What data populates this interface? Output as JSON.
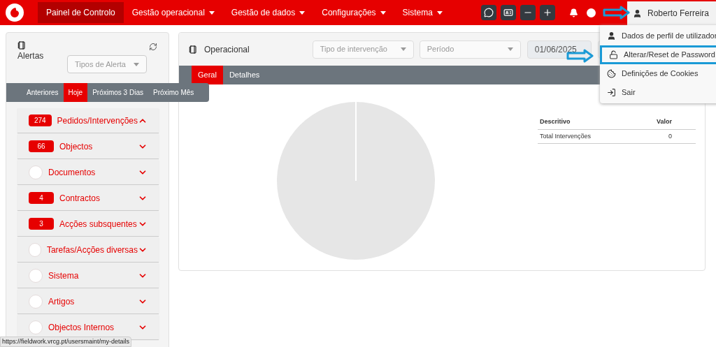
{
  "navbar": {
    "items": [
      {
        "label": "Painel de Controlo",
        "selected": true,
        "dropdown": false
      },
      {
        "label": "Gestão operacional",
        "selected": false,
        "dropdown": true
      },
      {
        "label": "Gestão de dados",
        "selected": false,
        "dropdown": true
      },
      {
        "label": "Configurações",
        "selected": false,
        "dropdown": true
      },
      {
        "label": "Sistema",
        "selected": false,
        "dropdown": true
      }
    ],
    "user": "Roberto Ferreira"
  },
  "user_menu": {
    "items": [
      {
        "label": "Dados de perfil de utilizador",
        "highlighted": false
      },
      {
        "label": "Alterar/Reset de Password",
        "highlighted": true
      },
      {
        "label": "Definições de Cookies",
        "highlighted": false
      },
      {
        "label": "Sair",
        "highlighted": false
      }
    ]
  },
  "alerts": {
    "title": "Alertas",
    "filter_placeholder": "Tipos de Alerta",
    "tabs": [
      {
        "label": "Anteriores",
        "selected": false
      },
      {
        "label": "Hoje",
        "selected": true
      },
      {
        "label": "Próximos 3 Dias",
        "selected": false
      },
      {
        "label": "Próximo Mês",
        "selected": false
      }
    ],
    "items": [
      {
        "count": "274",
        "label": "Pedidos/Intervenções",
        "expanded": true
      },
      {
        "count": "66",
        "label": "Objectos",
        "expanded": false
      },
      {
        "label": "Documentos",
        "expanded": false
      },
      {
        "count": "4",
        "label": "Contractos",
        "expanded": false
      },
      {
        "count": "3",
        "label": "Acções subsquentes",
        "expanded": false
      },
      {
        "label": "Tarefas/Acções diversas",
        "expanded": false
      },
      {
        "label": "Sistema",
        "expanded": false
      },
      {
        "label": "Artigos",
        "expanded": false
      },
      {
        "label": "Objectos Internos",
        "expanded": false
      }
    ]
  },
  "operational": {
    "title": "Operacional",
    "type_placeholder": "Tipo de intervenção",
    "period_placeholder": "Período",
    "date": "01/06/2025",
    "tabs": [
      {
        "label": "Geral",
        "selected": true
      },
      {
        "label": "Detalhes",
        "selected": false
      }
    ],
    "table": {
      "columns": [
        "Descritivo",
        "Valor"
      ],
      "rows": [
        [
          "Total Intervenções",
          "0"
        ]
      ]
    }
  },
  "status_url": "https://fieldwork.vrcg.pt/usersmaint/my-details"
}
